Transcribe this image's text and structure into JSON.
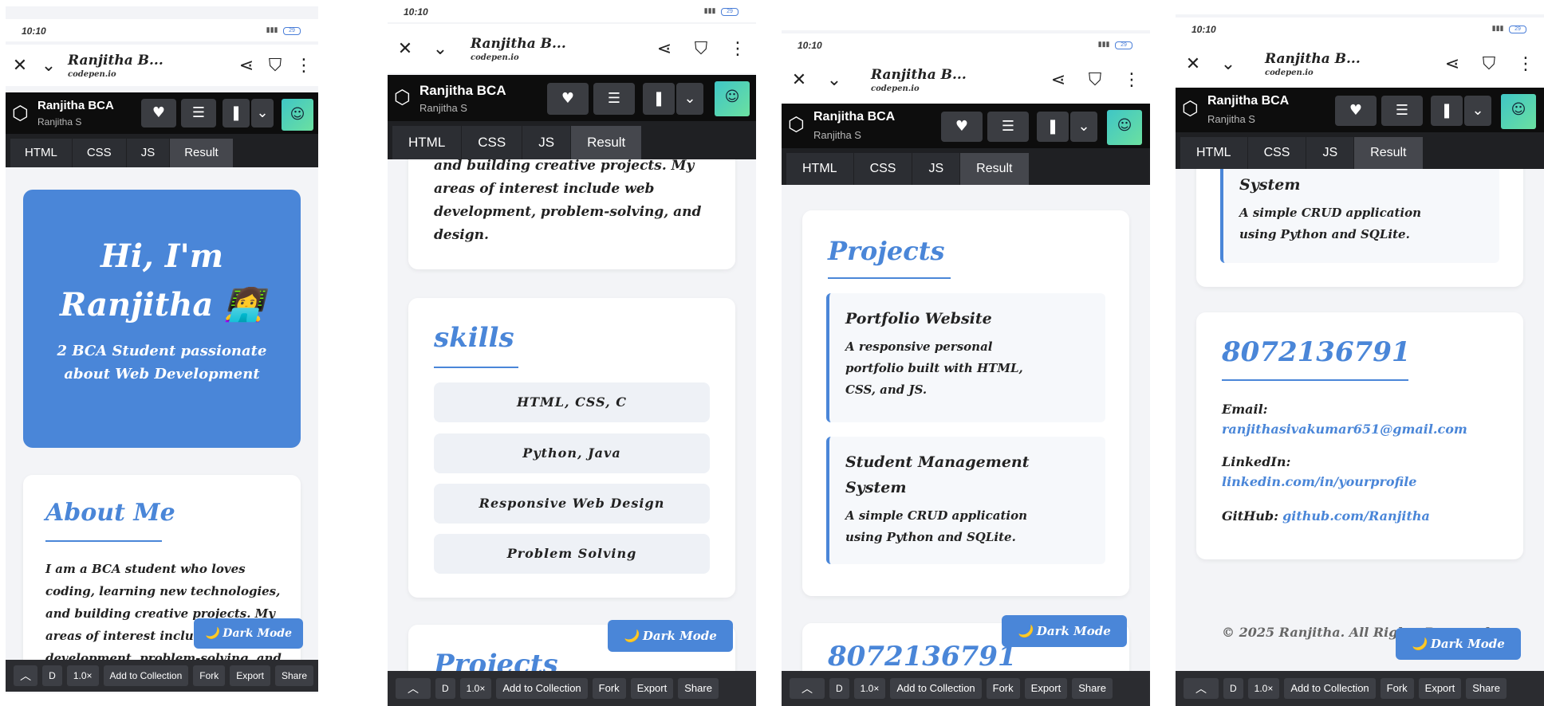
{
  "status": {
    "time": "10:10",
    "battery": "29"
  },
  "browser": {
    "title": "Ranjitha B...",
    "domain": "codepen.io"
  },
  "codepen": {
    "pen_title": "Ranjitha BCA",
    "author": "Ranjitha S"
  },
  "tabs": [
    "HTML",
    "CSS",
    "JS",
    "Result"
  ],
  "footer": {
    "d_label": "D",
    "zoom": "1.0×",
    "add": "Add to Collection",
    "fork": "Fork",
    "export": "Export",
    "share": "Share"
  },
  "page": {
    "hero_title_1": "Hi, I'm",
    "hero_title_2": "Ranjitha 👩‍💻",
    "hero_sub_1": "2 BCA Student passionate",
    "hero_sub_2": "about Web Development",
    "about_heading": "About Me",
    "about_lines": [
      "I am a BCA student who loves",
      "coding, learning new technologies,",
      "and building creative projects. My",
      "areas of interest include web",
      "development, problem-solving, and",
      "design."
    ],
    "skills_heading": "skills",
    "skills": [
      "HTML, CSS, C",
      "Python, Java",
      "Responsive Web Design",
      "Problem Solving"
    ],
    "projects_heading": "Projects",
    "projects": [
      {
        "title_lines": [
          "Portfolio Website"
        ],
        "desc_lines": [
          "A responsive personal",
          "portfolio built with HTML,",
          "CSS, and JS."
        ]
      },
      {
        "title_lines": [
          "Student Management",
          "System"
        ],
        "desc_lines": [
          "A simple CRUD application",
          "using Python and SQLite."
        ]
      }
    ],
    "contact_heading": "8072136791",
    "email_label": "Email:",
    "email": "ranjithasivakumar651@gmail.com",
    "linkedin_label": "LinkedIn:",
    "linkedin": "linkedin.com/in/yourprofile",
    "github_label": "GitHub:",
    "github": "github.com/Ranjitha",
    "copyright": "© 2025 Ranjitha. All Rights Reserved.",
    "dark_mode": "🌙 Dark Mode"
  }
}
